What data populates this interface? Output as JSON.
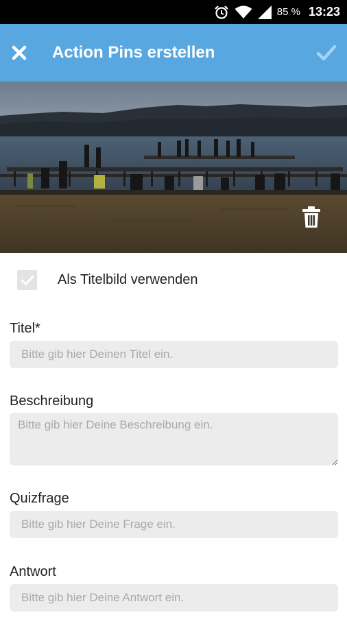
{
  "status_bar": {
    "battery": "85 %",
    "time": "13:23",
    "icons": [
      "alarm-icon",
      "wifi-icon",
      "cell-signal-icon"
    ]
  },
  "app_bar": {
    "title": "Action Pins erstellen",
    "close_icon": "close-icon",
    "confirm_icon": "check-icon",
    "color": "#58a7e0"
  },
  "image": {
    "delete_icon": "trash-icon"
  },
  "cover": {
    "checked": true,
    "label": "Als Titelbild verwenden"
  },
  "fields": {
    "title": {
      "label": "Titel*",
      "placeholder": "Bitte gib hier Deinen Titel ein.",
      "value": ""
    },
    "description": {
      "label": "Beschreibung",
      "placeholder": "Bitte gib hier Deine Beschreibung ein.",
      "value": ""
    },
    "quiz": {
      "label": "Quizfrage",
      "placeholder": "Bitte gib hier Deine Frage ein.",
      "value": ""
    },
    "answer": {
      "label": "Antwort",
      "placeholder": "Bitte gib hier Deine Antwort ein.",
      "value": ""
    }
  }
}
